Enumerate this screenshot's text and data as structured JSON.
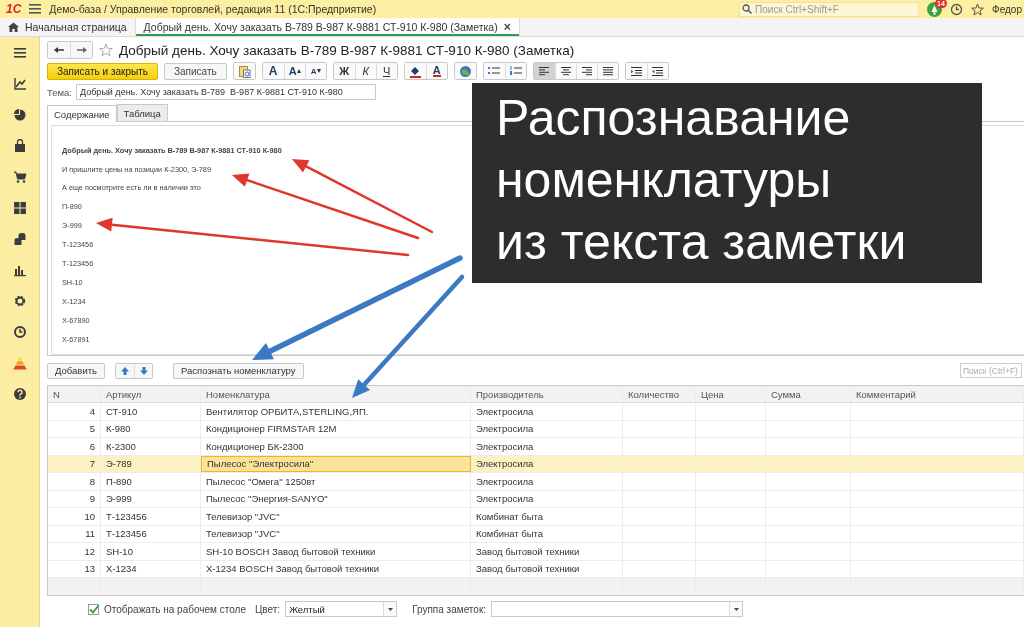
{
  "app_bar": {
    "logo": "1С",
    "title": "Демо-база / Управление торговлей, редакция 11  (1С:Предприятие)",
    "search": {
      "placeholder": "Поиск Ctrl+Shift+F"
    },
    "notifications": "14",
    "user": "Федор"
  },
  "open_tabs": [
    {
      "kind": "home",
      "label": "Начальная страница",
      "selected": false
    },
    {
      "kind": "document",
      "label": "Добрый день. Хочу заказать В-789  В-987 К-9881 СТ-910 К-980 (Заметка)",
      "close": "×",
      "selected": true
    }
  ],
  "form": {
    "title": "Добрый день. Хочу заказать В-789  В-987 К-9881 СТ-910 К-980 (Заметка)",
    "buttons": [
      {
        "kind": "primary",
        "label": "Записать и закрыть"
      },
      {
        "kind": "normal",
        "label": "Записать"
      }
    ],
    "format_groups": [
      {
        "items": [
          {
            "kind": "paste"
          }
        ]
      },
      {
        "items": [
          {
            "kind": "letter",
            "label": "A"
          },
          {
            "kind": "grow",
            "label": "A"
          },
          {
            "kind": "shrink",
            "label": "A"
          }
        ]
      },
      {
        "items": [
          {
            "kind": "bold",
            "label": "Ж"
          },
          {
            "kind": "italic",
            "label": "К"
          },
          {
            "kind": "underline",
            "label": "Ч"
          }
        ]
      },
      {
        "items": [
          {
            "kind": "fill"
          },
          {
            "kind": "color",
            "label": "A"
          }
        ]
      },
      {
        "items": [
          {
            "kind": "image"
          }
        ]
      },
      {
        "items": [
          {
            "kind": "bullets"
          },
          {
            "kind": "numbering"
          }
        ]
      },
      {
        "items": [
          {
            "kind": "align-left",
            "selected": true
          },
          {
            "kind": "align-center",
            "selected": false
          },
          {
            "kind": "align-right",
            "selected": false
          },
          {
            "kind": "justify",
            "selected": false
          }
        ]
      },
      {
        "items": [
          {
            "kind": "indent"
          },
          {
            "kind": "outdent"
          }
        ]
      }
    ],
    "subject": {
      "label": "Тема:",
      "value": "Добрый день. Хочу заказать В-789  В-987 К-9881 СТ-910 К-980"
    },
    "content_tabs": [
      {
        "label": "Содержание",
        "selected": true
      },
      {
        "label": "Таблица",
        "selected": false
      }
    ],
    "note_text": [
      {
        "kind": "heading",
        "text": "Добрый день. Хочу заказать В-789  В-987 К-9881 СТ-910 К-980"
      },
      {
        "kind": "line",
        "text": "И пришлите цены на позиции К-2300, Э-789"
      },
      {
        "kind": "line",
        "text": "А еще посмотрите есть ли в наличии это"
      },
      {
        "kind": "item",
        "text": "П-890"
      },
      {
        "kind": "item",
        "text": "Э-999"
      },
      {
        "kind": "item",
        "text": "Т-123456"
      },
      {
        "kind": "item",
        "text": "Т-123456"
      },
      {
        "kind": "item",
        "text": "SH-10"
      },
      {
        "kind": "item",
        "text": "Х-1234"
      },
      {
        "kind": "item",
        "text": "Х-67890"
      },
      {
        "kind": "item",
        "text": "Х-67891"
      }
    ]
  },
  "table_toolbar": {
    "add": "Добавить",
    "recognize": "Распознать номенклатуру",
    "search": {
      "placeholder": "Поиск (Ctrl+F)"
    }
  },
  "table": {
    "columns": [
      "N",
      "Артикул",
      "Номенклатура",
      "Производитель",
      "Количество",
      "Цена",
      "Сумма",
      "Комментарий"
    ],
    "rows": [
      {
        "cells": [
          "4",
          "СТ-910",
          "Вентилятор ОРБИТА,STERLING,ЯП.",
          "Электросила"
        ],
        "selected": false
      },
      {
        "cells": [
          "5",
          "К-980",
          "Кондиционер FIRMSTAR 12М",
          "Электросила"
        ],
        "selected": false
      },
      {
        "cells": [
          "6",
          "К-2300",
          "Кондиционер БК-2300",
          "Электросила"
        ],
        "selected": false
      },
      {
        "cells": [
          "7",
          "Э-789",
          "Пылесос \"Электросила\"",
          "Электросила"
        ],
        "selected": true
      },
      {
        "cells": [
          "8",
          "П-890",
          "Пылесос \"Омега\" 1250вт",
          "Электросила"
        ],
        "selected": false
      },
      {
        "cells": [
          "9",
          "Э-999",
          "Пылесос \"Энергия-SANYO\"",
          "Электросила"
        ],
        "selected": false
      },
      {
        "cells": [
          "10",
          "Т-123456",
          "Телевизор \"JVC\"",
          "Комбинат быта"
        ],
        "selected": false
      },
      {
        "cells": [
          "11",
          "Т-123456",
          "Телевизор \"JVC\"",
          "Комбинат быта"
        ],
        "selected": false
      },
      {
        "cells": [
          "12",
          "SH-10",
          "SH-10 BOSCH Завод бытовой техники",
          "Завод бытовой техники"
        ],
        "selected": false
      },
      {
        "cells": [
          "13",
          "Х-1234",
          "Х-1234 BOSCH Завод бытовой техники",
          "Завод бытовой техники"
        ],
        "selected": false
      }
    ]
  },
  "footer": {
    "show_on_desktop": {
      "label": "Отображать на рабочем столе",
      "checked": true
    },
    "color": {
      "label": "Цвет:",
      "value": "Желтый"
    },
    "group": {
      "label": "Группа заметок:"
    }
  },
  "overlay": {
    "lines": [
      "Распознавание",
      "номенклатуры",
      "из текста заметки"
    ]
  }
}
